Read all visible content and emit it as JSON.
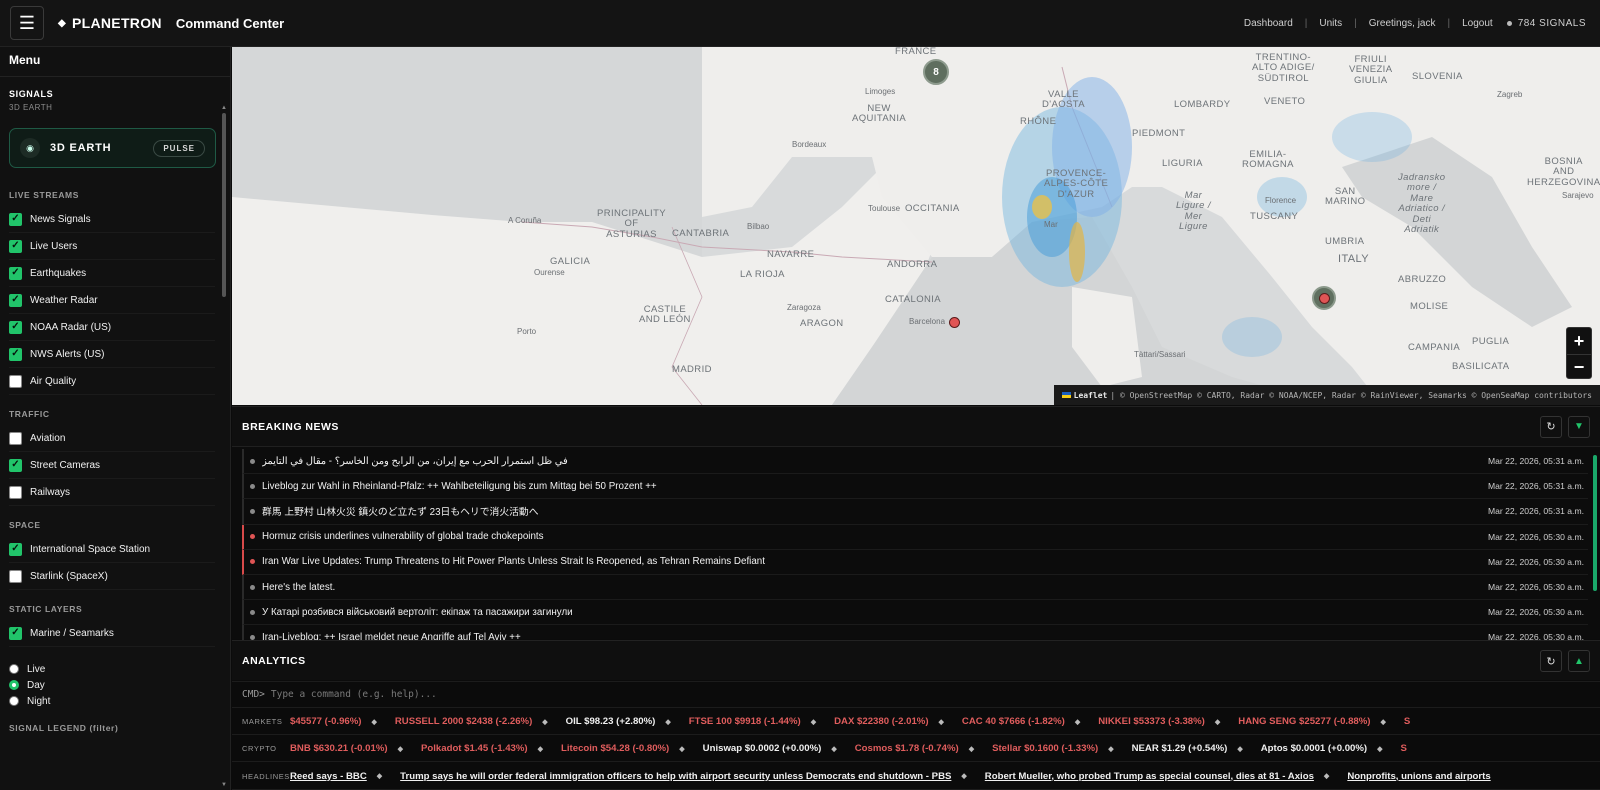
{
  "header": {
    "brand": "PLANETRON",
    "app_title": "Command Center",
    "nav": [
      "Dashboard",
      "Units",
      "Greetings, jack",
      "Logout"
    ],
    "signals_count": "784 SIGNALS"
  },
  "sidebar": {
    "menu_title": "Menu",
    "signals_heading": "SIGNALS",
    "signals_sub": "3D EARTH",
    "pulse_card": {
      "label": "3D EARTH",
      "button": "PULSE"
    },
    "live_streams": {
      "label": "LIVE STREAMS",
      "items": [
        {
          "label": "News Signals",
          "checked": true
        },
        {
          "label": "Live Users",
          "checked": true
        },
        {
          "label": "Earthquakes",
          "checked": true
        },
        {
          "label": "Weather Radar",
          "checked": true
        },
        {
          "label": "NOAA Radar (US)",
          "checked": true
        },
        {
          "label": "NWS Alerts (US)",
          "checked": true
        },
        {
          "label": "Air Quality",
          "checked": false
        }
      ]
    },
    "traffic": {
      "label": "TRAFFIC",
      "items": [
        {
          "label": "Aviation",
          "checked": false
        },
        {
          "label": "Street Cameras",
          "checked": true
        },
        {
          "label": "Railways",
          "checked": false
        }
      ]
    },
    "space": {
      "label": "SPACE",
      "items": [
        {
          "label": "International Space Station",
          "checked": true
        },
        {
          "label": "Starlink (SpaceX)",
          "checked": false
        }
      ]
    },
    "static_layers": {
      "label": "STATIC LAYERS",
      "items": [
        {
          "label": "Marine / Seamarks",
          "checked": true
        }
      ]
    },
    "basemap": {
      "options": [
        "Live",
        "Day",
        "Night"
      ],
      "selected": "Day"
    },
    "signal_legend": "SIGNAL LEGEND (filter)"
  },
  "map": {
    "labels": {
      "france": "FRANCE",
      "new_aquitania": "NEW\nAQUITANIA",
      "occitania": "OCCITANIA",
      "principality": "PRINCIPALITY\nOF\nASTURIAS",
      "cantabria": "CANTABRIA",
      "galicia": "GALICIA",
      "navarre": "NAVARRE",
      "la_rioja": "LA RIOJA",
      "andorra": "ANDORRA",
      "catalonia": "CATALONIA",
      "castile": "CASTILE\nAND LEÓN",
      "aragon": "ARAGON",
      "madrid": "MADRID",
      "valle": "VALLE\nD'AOSTA",
      "piedmont": "PIEDMONT",
      "lombardy": "LOMBARDY",
      "veneto": "VENETO",
      "trentino": "TRENTINO-\nALTO ADIGE/\nSÜDTIROL",
      "friuli": "FRIULI\nVENEZIA\nGIULIA",
      "slovenia": "SLOVENIA",
      "rhone": "RHÔNE",
      "provence": "PROVENCE-\nALPES-CÔTE\nD'AZUR",
      "liguria": "LIGURIA",
      "emilia": "EMILIA-\nROMAGNA",
      "tuscany": "TUSCANY",
      "umbria": "UMBRIA",
      "italy": "ITALY",
      "abruzzo": "ABRUZZO",
      "molise": "MOLISE",
      "puglia": "PUGLIA",
      "campania": "CAMPANIA",
      "basilicata": "BASILICATA",
      "bosnia": "BOSNIA\nAND\nHERZEGOVINA",
      "san_marino": "SAN\nMARINO",
      "ligure": "Mar\nLigure /\nMer\nLigure",
      "adriatico": "Jadransko\nmore /\nMare\nAdriatico /\nDeti\nAdriatik",
      "limoges": "Limoges",
      "bordeaux": "Bordeaux",
      "toulouse": "Toulouse",
      "bilbao": "Bilbao",
      "coruna": "A Coruña",
      "ourense": "Ourense",
      "zaragoza": "Zaragoza",
      "porto": "Porto",
      "barcelona": "Barcelona",
      "zagreb": "Zagreb",
      "sarajevo": "Sarajevo",
      "florence": "Florence",
      "tattari": "Tàttari/Sassari",
      "marseille": "Mar"
    },
    "cluster_count": "8",
    "zoom_in": "+",
    "zoom_out": "−",
    "attribution_leaflet": "Leaflet",
    "attribution_rest": "| © OpenStreetMap © CARTO, Radar © NOAA/NCEP, Radar © RainViewer, Seamarks © OpenSeaMap contributors"
  },
  "breaking_news": {
    "title": "BREAKING NEWS",
    "items": [
      {
        "text": "في ظل استمرار الحرب مع إيران، من الرابح ومن الخاسر؟ - مقال في التايمز",
        "time": "Mar 22, 2026, 05:31 a.m.",
        "alert": false
      },
      {
        "text": "Liveblog zur Wahl in Rheinland-Pfalz: ++ Wahlbeteiligung bis zum Mittag bei 50 Prozent ++",
        "time": "Mar 22, 2026, 05:31 a.m.",
        "alert": false
      },
      {
        "text": "群馬 上野村 山林火災 鎮火のど立たず 23日もヘリで消火活動へ",
        "time": "Mar 22, 2026, 05:31 a.m.",
        "alert": false
      },
      {
        "text": "Hormuz crisis underlines vulnerability of global trade chokepoints",
        "time": "Mar 22, 2026, 05:30 a.m.",
        "alert": true
      },
      {
        "text": "Iran War Live Updates: Trump Threatens to Hit Power Plants Unless Strait Is Reopened, as Tehran Remains Defiant",
        "time": "Mar 22, 2026, 05:30 a.m.",
        "alert": true
      },
      {
        "text": "Here's the latest.",
        "time": "Mar 22, 2026, 05:30 a.m.",
        "alert": false
      },
      {
        "text": "У Катарі розбився військовий вертоліт: екіпаж та пасажири загинули",
        "time": "Mar 22, 2026, 05:30 a.m.",
        "alert": false
      },
      {
        "text": "Iran-Liveblog: ++ Israel meldet neue Angriffe auf Tel Aviv ++",
        "time": "Mar 22, 2026, 05:30 a.m.",
        "alert": false
      }
    ]
  },
  "analytics": {
    "title": "ANALYTICS",
    "cmd_prompt": "CMD>",
    "cmd_placeholder": "Type a command (e.g. help)..."
  },
  "tickers": {
    "markets": {
      "label": "MARKETS",
      "items": [
        {
          "text": "$45577 (-0.96%)",
          "dir": "neg"
        },
        {
          "text": "RUSSELL 2000 $2438 (-2.26%)",
          "dir": "neg"
        },
        {
          "text": "OIL $98.23 (+2.80%)",
          "dir": "pos"
        },
        {
          "text": "FTSE 100 $9918 (-1.44%)",
          "dir": "neg"
        },
        {
          "text": "DAX $22380 (-2.01%)",
          "dir": "neg"
        },
        {
          "text": "CAC 40 $7666 (-1.82%)",
          "dir": "neg"
        },
        {
          "text": "NIKKEI $53373 (-3.38%)",
          "dir": "neg"
        },
        {
          "text": "HANG SENG $25277 (-0.88%)",
          "dir": "neg"
        },
        {
          "text": "S",
          "dir": "neg"
        }
      ]
    },
    "crypto": {
      "label": "CRYPTO",
      "items": [
        {
          "text": "BNB $630.21 (-0.01%)",
          "dir": "neg"
        },
        {
          "text": "Polkadot $1.45 (-1.43%)",
          "dir": "neg"
        },
        {
          "text": "Litecoin $54.28 (-0.80%)",
          "dir": "neg"
        },
        {
          "text": "Uniswap $0.0002 (+0.00%)",
          "dir": "pos"
        },
        {
          "text": "Cosmos $1.78 (-0.74%)",
          "dir": "neg"
        },
        {
          "text": "Stellar $0.1600 (-1.33%)",
          "dir": "neg"
        },
        {
          "text": "NEAR $1.29 (+0.54%)",
          "dir": "pos"
        },
        {
          "text": "Aptos $0.0001 (+0.00%)",
          "dir": "pos"
        },
        {
          "text": "S",
          "dir": "neg"
        }
      ]
    },
    "headlines": {
      "label": "HEADLINES",
      "items": [
        {
          "text": "Reed says - BBC",
          "dir": "head"
        },
        {
          "text": "Trump says he will order federal immigration officers to help with airport security unless Democrats end shutdown - PBS",
          "dir": "head"
        },
        {
          "text": "Robert Mueller, who probed Trump as special counsel, dies at 81 - Axios",
          "dir": "head"
        },
        {
          "text": "Nonprofits, unions and airports",
          "dir": "head"
        }
      ]
    }
  },
  "colors": {
    "accent_green": "#21c46a",
    "alert_red": "#e05555",
    "negative": "#e05d5d"
  }
}
